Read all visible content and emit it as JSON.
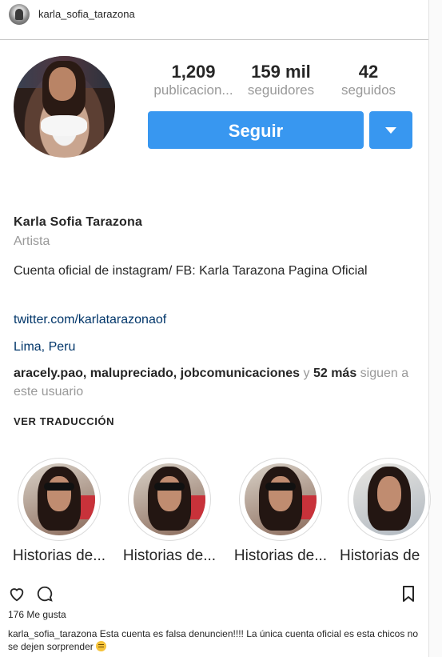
{
  "header": {
    "username": "karla_sofia_tarazona"
  },
  "stats": [
    {
      "value": "1,209",
      "label": "publicacion..."
    },
    {
      "value": "159 mil",
      "label": "seguidores"
    },
    {
      "value": "42",
      "label": "seguidos"
    }
  ],
  "actions": {
    "follow_label": "Seguir"
  },
  "profile": {
    "name": "Karla Sofia Tarazona",
    "category": "Artista",
    "bio": "Cuenta oficial de instagram/ FB: Karla Tarazona Pagina Oficial",
    "link": "twitter.com/karlatarazonaof",
    "location": "Lima, Peru",
    "followed_by": {
      "names": "aracely.pao, malupreciado, jobcomunicaciones",
      "joiner": "y",
      "more": "52 más",
      "suffix": "siguen a este usuario"
    },
    "translate_label": "VER TRADUCCIÓN"
  },
  "highlights": [
    {
      "label": "Historias de..."
    },
    {
      "label": "Historias de..."
    },
    {
      "label": "Historias de..."
    },
    {
      "label": "Historias de"
    }
  ],
  "post": {
    "likes": "176 Me gusta",
    "caption_user": "karla_sofia_tarazona",
    "caption_text": "Esta cuenta es falsa denuncien!!!! La única cuenta oficial es esta chicos no se dejen sorprender",
    "icons": [
      "heart-icon",
      "comment-icon",
      "bookmark-icon"
    ]
  },
  "colors": {
    "accent": "#3897f0",
    "muted": "#999999",
    "link": "#003569",
    "text": "#262626"
  }
}
